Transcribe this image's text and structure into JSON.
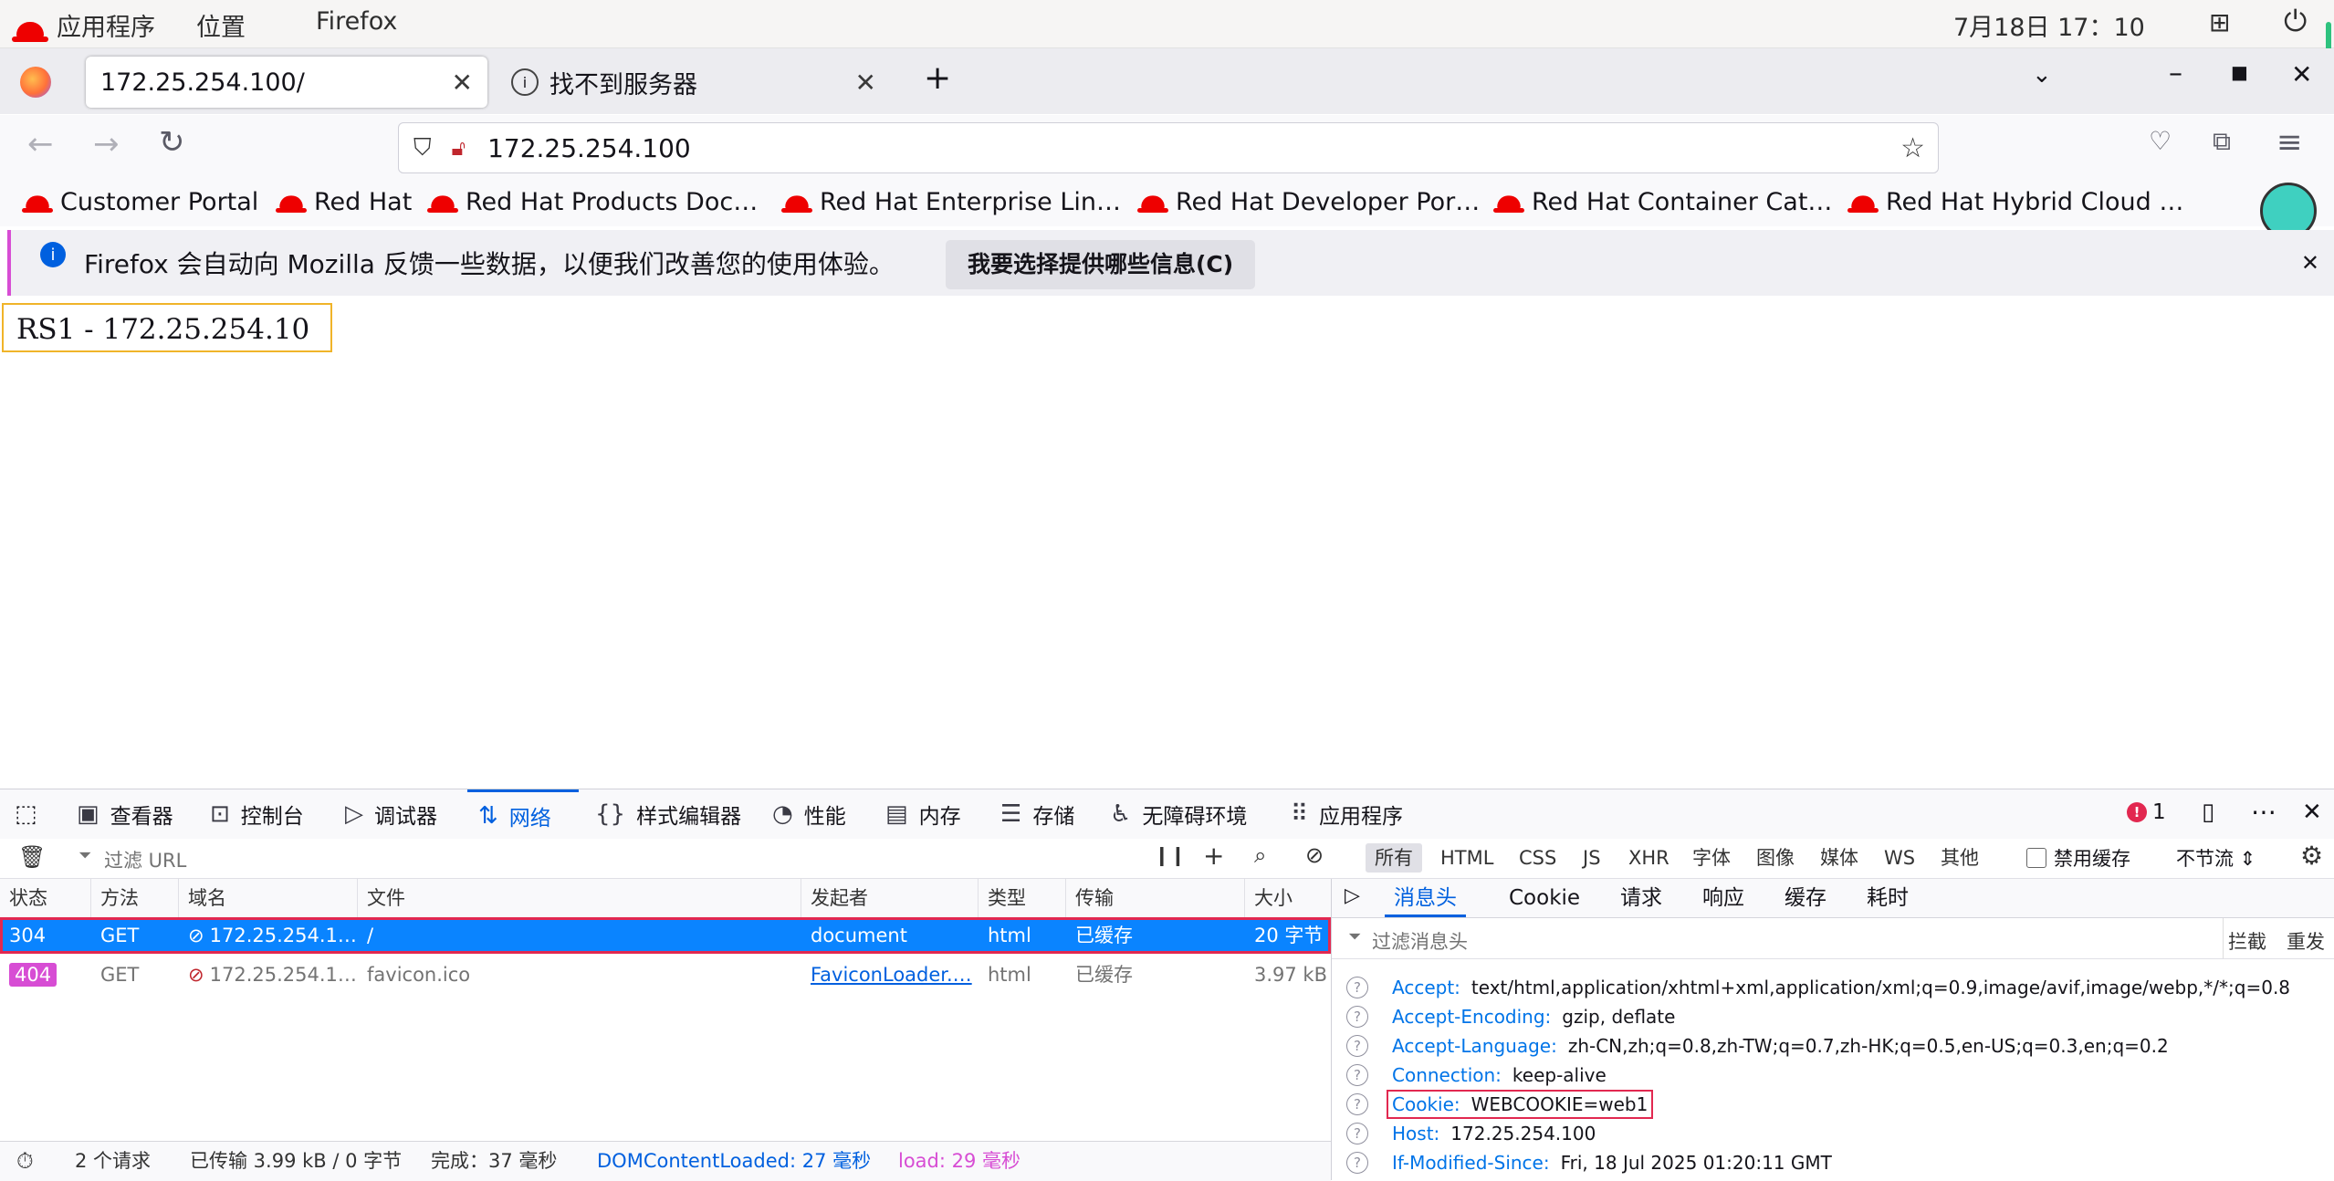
{
  "topbar": {
    "apps_label": "应用程序",
    "places_label": "位置",
    "app_name": "Firefox",
    "datetime": "7月18日 17：10"
  },
  "tabs": [
    {
      "label": "172.25.254.100/",
      "active": true
    },
    {
      "label": "找不到服务器",
      "active": false
    }
  ],
  "url": "172.25.254.100",
  "bookmarks": [
    "Customer Portal",
    "Red Hat",
    "Red Hat Products Doc…",
    "Red Hat Enterprise Lin…",
    "Red Hat Developer Por…",
    "Red Hat Container Cat…",
    "Red Hat Hybrid Cloud …"
  ],
  "notification": {
    "text": "Firefox 会自动向 Mozilla 反馈一些数据，以便我们改善您的使用体验。",
    "button": "我要选择提供哪些信息(C)"
  },
  "page": {
    "text": "RS1 - 172.25.254.10"
  },
  "devtools": {
    "tabs": [
      "查看器",
      "控制台",
      "调试器",
      "网络",
      "样式编辑器",
      "性能",
      "内存",
      "存储",
      "无障碍环境",
      "应用程序"
    ],
    "active_tab": "网络",
    "error_count": "1",
    "filter_placeholder": "过滤 URL",
    "pause_label": "❙❙",
    "type_filters": [
      "所有",
      "HTML",
      "CSS",
      "JS",
      "XHR",
      "字体",
      "图像",
      "媒体",
      "WS",
      "其他"
    ],
    "disable_cache_label": "禁用缓存",
    "throttle_label": "不节流 ⇕",
    "columns": [
      "状态",
      "方法",
      "域名",
      "文件",
      "发起者",
      "类型",
      "传输",
      "大小"
    ],
    "rows": [
      {
        "status": "304",
        "method": "GET",
        "domain": "172.25.254.1…",
        "file": "/",
        "initiator": "document",
        "type": "html",
        "transfer": "已缓存",
        "size": "20 字节"
      },
      {
        "status": "404",
        "method": "GET",
        "domain": "172.25.254.1…",
        "file": "favicon.ico",
        "initiator": "FaviconLoader.…",
        "type": "html",
        "transfer": "已缓存",
        "size": "3.97 kB"
      }
    ],
    "status_bar": {
      "requests": "2 个请求",
      "transferred": "已传输 3.99 kB / 0 字节",
      "finish": "完成：37 毫秒",
      "dom_loaded": "DOMContentLoaded: 27 毫秒",
      "load": "load: 29 毫秒"
    },
    "side_tabs": [
      "消息头",
      "Cookie",
      "请求",
      "响应",
      "缓存",
      "耗时"
    ],
    "side_filter_placeholder": "过滤消息头",
    "block_label": "拦截",
    "resend_label": "重发",
    "headers": [
      {
        "name": "Accept:",
        "value": "text/html,application/xhtml+xml,application/xml;q=0.9,image/avif,image/webp,*/*;q=0.8"
      },
      {
        "name": "Accept-Encoding:",
        "value": "gzip, deflate"
      },
      {
        "name": "Accept-Language:",
        "value": "zh-CN,zh;q=0.8,zh-TW;q=0.7,zh-HK;q=0.5,en-US;q=0.3,en;q=0.2"
      },
      {
        "name": "Connection:",
        "value": "keep-alive"
      },
      {
        "name": "Cookie:",
        "value": "WEBCOOKIE=web1"
      },
      {
        "name": "Host:",
        "value": "172.25.254.100"
      },
      {
        "name": "If-Modified-Since:",
        "value": "Fri, 18 Jul 2025 01:20:11 GMT"
      }
    ]
  },
  "colors": {
    "accent": "#0060df",
    "selected_row": "#0a84ff",
    "highlight_box": "#e22850",
    "redhat": "#ee0000"
  }
}
